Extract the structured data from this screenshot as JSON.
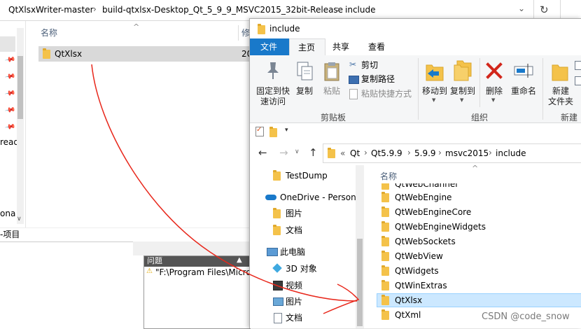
{
  "back_window": {
    "breadcrumb": [
      "QtXlsxWriter-master",
      "build-qtxlsx-Desktop_Qt_5_9_9_MSVC2015_32bit-Release",
      "include"
    ],
    "column_name": "名称",
    "column_modified_partial": "修",
    "row_name": "QtXlsx",
    "row_date_partial": "20",
    "left_nav_partial_1": "read",
    "left_nav_partial_2": "ona",
    "status_partial": "-项目",
    "refresh_icon": "refresh-icon"
  },
  "error_panel": {
    "header": "问题",
    "row": "\"F:\\Program Files\\Micros"
  },
  "front_window": {
    "title": "include",
    "tabs": [
      "文件",
      "主页",
      "共享",
      "查看"
    ],
    "ribbon": {
      "pin_quick": "固定到快\n速访问",
      "copy": "复制",
      "paste": "粘贴",
      "cut": "剪切",
      "copy_path": "复制路径",
      "paste_shortcut": "粘贴快捷方式",
      "clipboard_group": "剪贴板",
      "move_to": "移动到",
      "copy_to": "复制到",
      "delete": "删除",
      "rename": "重命名",
      "organize_group": "组织",
      "new_folder": "新建\n文件夹",
      "new_group": "新建"
    },
    "address": [
      "«",
      "Qt",
      "Qt5.9.9",
      "5.9.9",
      "msvc2015",
      "include"
    ],
    "nav": [
      {
        "label": "TestDump",
        "icon": "folder-icon"
      },
      {
        "label": "OneDrive - Persona",
        "icon": "onedrive-icon"
      },
      {
        "label": "图片",
        "icon": "folder-icon"
      },
      {
        "label": "文档",
        "icon": "folder-icon"
      },
      {
        "label": "此电脑",
        "icon": "computer-icon"
      },
      {
        "label": "3D 对象",
        "icon": "3d-objects-icon"
      },
      {
        "label": "视频",
        "icon": "video-icon"
      },
      {
        "label": "图片",
        "icon": "pictures-icon"
      },
      {
        "label": "文档",
        "icon": "documents-icon"
      }
    ],
    "list_header": "名称",
    "files": [
      "QtWebChannel",
      "QtWebEngine",
      "QtWebEngineCore",
      "QtWebEngineWidgets",
      "QtWebSockets",
      "QtWebView",
      "QtWidgets",
      "QtWinExtras",
      "QtXlsx",
      "QtXml"
    ],
    "selected_file": "QtXlsx"
  },
  "watermark": "CSDN @code_snow",
  "colors": {
    "accent": "#1979ca",
    "selection": "#cce8ff",
    "annotation": "#e8281c"
  }
}
